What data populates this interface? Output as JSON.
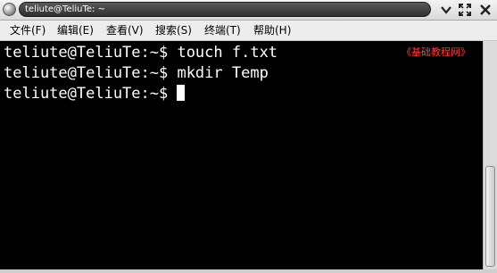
{
  "window": {
    "title": "teliute@TeliuTe: ~"
  },
  "titlebar_icons": {
    "menu": "window-menu-icon",
    "minimize": "chevron-down-icon",
    "maximize": "maximize-icon",
    "close": "close-icon"
  },
  "menubar": {
    "items": [
      {
        "label": "文件(F)"
      },
      {
        "label": "编辑(E)"
      },
      {
        "label": "查看(V)"
      },
      {
        "label": "搜索(S)"
      },
      {
        "label": "终端(T)"
      },
      {
        "label": "帮助(H)"
      }
    ]
  },
  "terminal": {
    "lines": [
      "teliute@TeliuTe:~$ touch f.txt",
      "teliute@TeliuTe:~$ mkdir Temp",
      "teliute@TeliuTe:~$ "
    ],
    "watermark": "《基础教程网》",
    "colors": {
      "background": "#000000",
      "foreground": "#ffffff",
      "watermark": "#ff3d3d"
    }
  }
}
